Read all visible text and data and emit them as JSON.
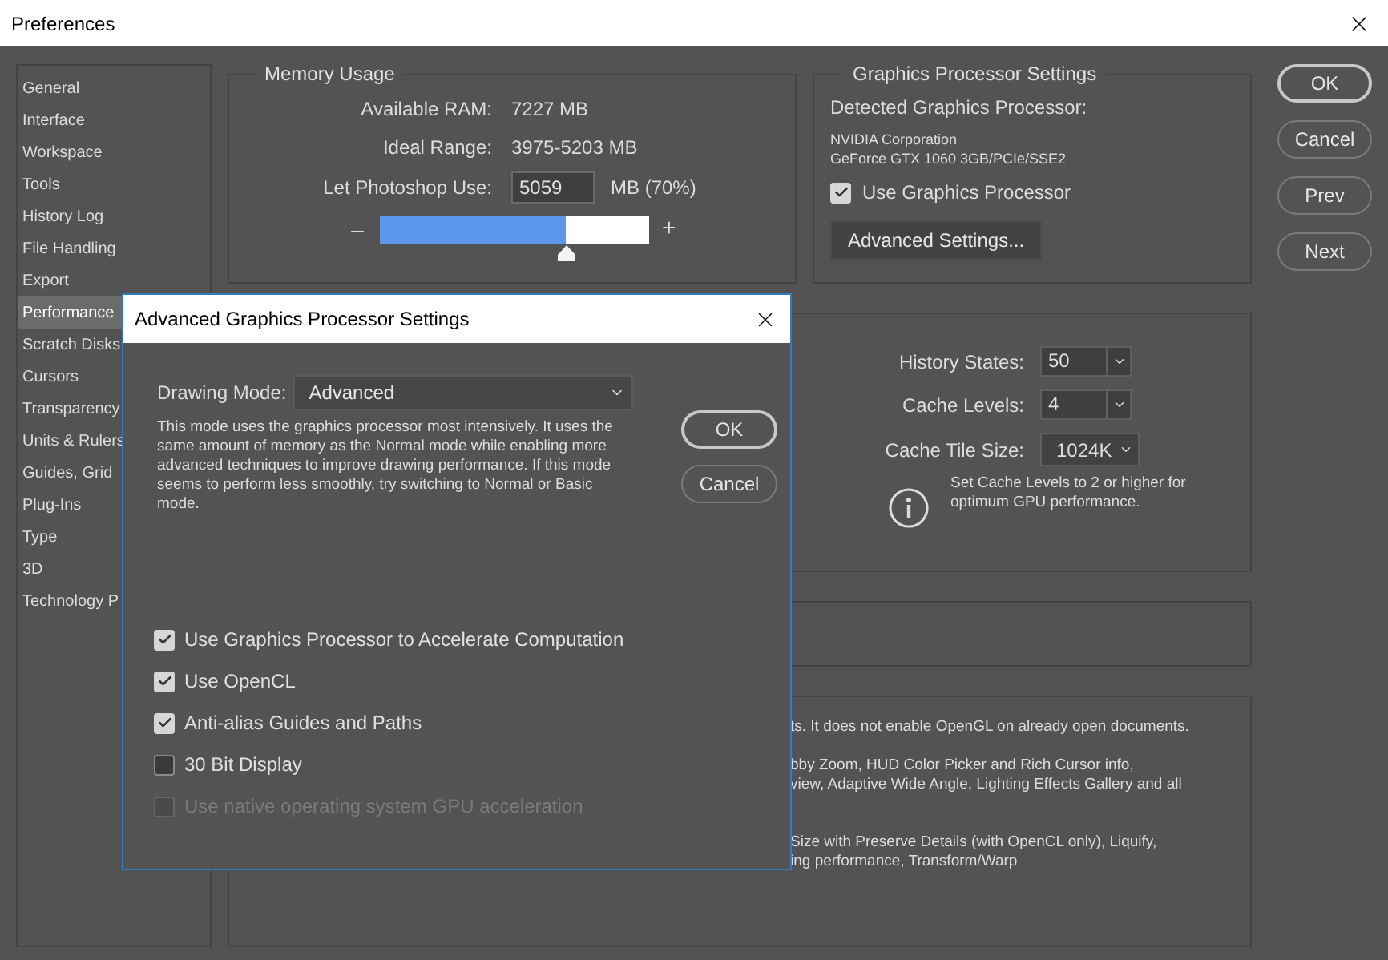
{
  "window": {
    "title": "Preferences"
  },
  "sidebar": {
    "items": [
      {
        "label": "General",
        "selected": false
      },
      {
        "label": "Interface",
        "selected": false
      },
      {
        "label": "Workspace",
        "selected": false
      },
      {
        "label": "Tools",
        "selected": false
      },
      {
        "label": "History Log",
        "selected": false
      },
      {
        "label": "File Handling",
        "selected": false
      },
      {
        "label": "Export",
        "selected": false
      },
      {
        "label": "Performance",
        "selected": true
      },
      {
        "label": "Scratch Disks",
        "selected": false
      },
      {
        "label": "Cursors",
        "selected": false
      },
      {
        "label": "Transparency",
        "selected": false
      },
      {
        "label": "Units & Rulers",
        "selected": false
      },
      {
        "label": "Guides, Grid",
        "selected": false
      },
      {
        "label": "Plug-Ins",
        "selected": false
      },
      {
        "label": "Type",
        "selected": false
      },
      {
        "label": "3D",
        "selected": false
      },
      {
        "label": "Technology P",
        "selected": false
      }
    ]
  },
  "memory_usage": {
    "title": "Memory Usage",
    "rows": [
      {
        "label": "Available RAM:",
        "value": "7227 MB"
      },
      {
        "label": "Ideal Range:",
        "value": "3975-5203 MB"
      }
    ],
    "photoshop_use": {
      "label": "Let Photoshop Use:",
      "value": "5059",
      "unit": "MB (70%)"
    },
    "slider": {
      "minus": "–",
      "plus": "+",
      "level": 0.69
    }
  },
  "graphics": {
    "title": "Graphics Processor Settings",
    "detected_label": "Detected Graphics Processor:",
    "processor_lines": [
      "NVIDIA Corporation",
      "GeForce GTX 1060 3GB/PCIe/SSE2"
    ],
    "use_gpu": {
      "label": "Use Graphics Processor",
      "checked": true
    },
    "advanced_button": "Advanced Settings..."
  },
  "buttons": [
    {
      "label": "OK",
      "default": true
    },
    {
      "label": "Cancel",
      "default": false
    },
    {
      "label": "Prev",
      "default": false
    },
    {
      "label": "Next",
      "default": false
    }
  ],
  "history": {
    "fields": [
      {
        "label": "History States:",
        "value": "50",
        "kind": "combo"
      },
      {
        "label": "Cache Levels:",
        "value": "4",
        "kind": "combo"
      },
      {
        "label": "Cache Tile Size:",
        "value": "1024K",
        "kind": "select"
      }
    ],
    "info_note": "Set Cache Levels to 2 or higher for optimum GPU performance."
  },
  "bottom_panel": {
    "lines": [
      "ts. It does not enable OpenGL on already open documents.",
      "bby Zoom, HUD Color Picker and Rich Cursor info,",
      "view, Adaptive Wide Angle, Lighting Effects Gallery and all",
      "Size with Preserve Details (with OpenCL only), Liquify,",
      "ing performance, Transform/Warp"
    ]
  },
  "dialog": {
    "title": "Advanced Graphics Processor Settings",
    "drawing_mode": {
      "label": "Drawing Mode:",
      "value": "Advanced"
    },
    "description": "This mode uses the graphics processor most intensively.  It uses the same amount of memory as the Normal mode while enabling more advanced techniques to improve drawing performance.  If this mode seems to perform less smoothly, try switching to Normal or Basic mode.",
    "buttons": [
      {
        "label": "OK",
        "default": true
      },
      {
        "label": "Cancel",
        "default": false
      }
    ],
    "options": [
      {
        "label": "Use Graphics Processor to Accelerate Computation",
        "checked": true,
        "disabled": false
      },
      {
        "label": "Use OpenCL",
        "checked": true,
        "disabled": false
      },
      {
        "label": "Anti-alias Guides and Paths",
        "checked": true,
        "disabled": false
      },
      {
        "label": "30 Bit Display",
        "checked": false,
        "disabled": false
      },
      {
        "label": "Use native operating system GPU acceleration",
        "checked": false,
        "disabled": true
      }
    ]
  }
}
